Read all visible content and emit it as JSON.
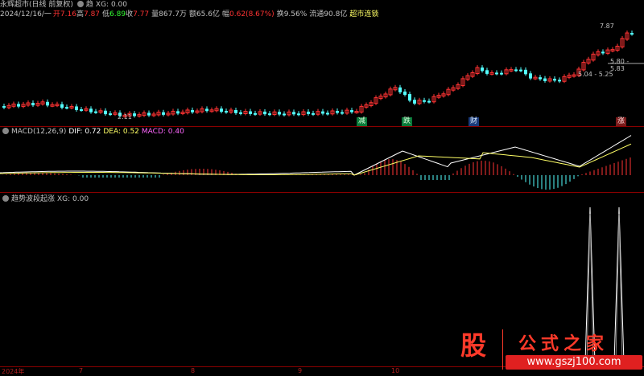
{
  "main": {
    "title": "永辉超市(日线 前复权)",
    "indicator_name": "趋",
    "xg": "XG: 0.00",
    "date": "2024/12/16/一",
    "open_label": "开",
    "open": "7.16",
    "high_label": "高",
    "high": "7.87",
    "low_label": "低",
    "low": "6.89",
    "close_label": "收",
    "close": "7.77",
    "vol_label": "量",
    "vol": "867.7万",
    "amt_label": "额",
    "amt": "65.6亿",
    "chg_label": "幅",
    "chg": "0.62(8.67%)",
    "turn_label": "换",
    "turn": "9.56%",
    "float_label": "流通",
    "float": "90.8亿",
    "tag": "超市连锁",
    "price_labels": {
      "p1": "7.87",
      "p2": "5.80 - 5.83",
      "p3": "5.04 - 5.25",
      "p4": "2.11"
    },
    "events": [
      "减",
      "跌",
      "财",
      "涨"
    ]
  },
  "macd": {
    "label": "MACD(12,26,9)",
    "dif": "DIF: 0.72",
    "dea": "DEA: 0.52",
    "macd": "MACD: 0.40"
  },
  "sub3": {
    "label": "趋势波段起涨",
    "xg": "XG: 0.00"
  },
  "axis": [
    "2024年",
    "7",
    "8",
    "9",
    "10"
  ],
  "watermark": {
    "logo": "股",
    "title": "公式之家",
    "url": "www.gszj100.com"
  },
  "colors": {
    "up": "#ff3333",
    "down": "#54ffff",
    "dif": "#ffffff",
    "dea": "#ffff66",
    "macd": "#ff66ff",
    "accent": "#e02020"
  }
}
